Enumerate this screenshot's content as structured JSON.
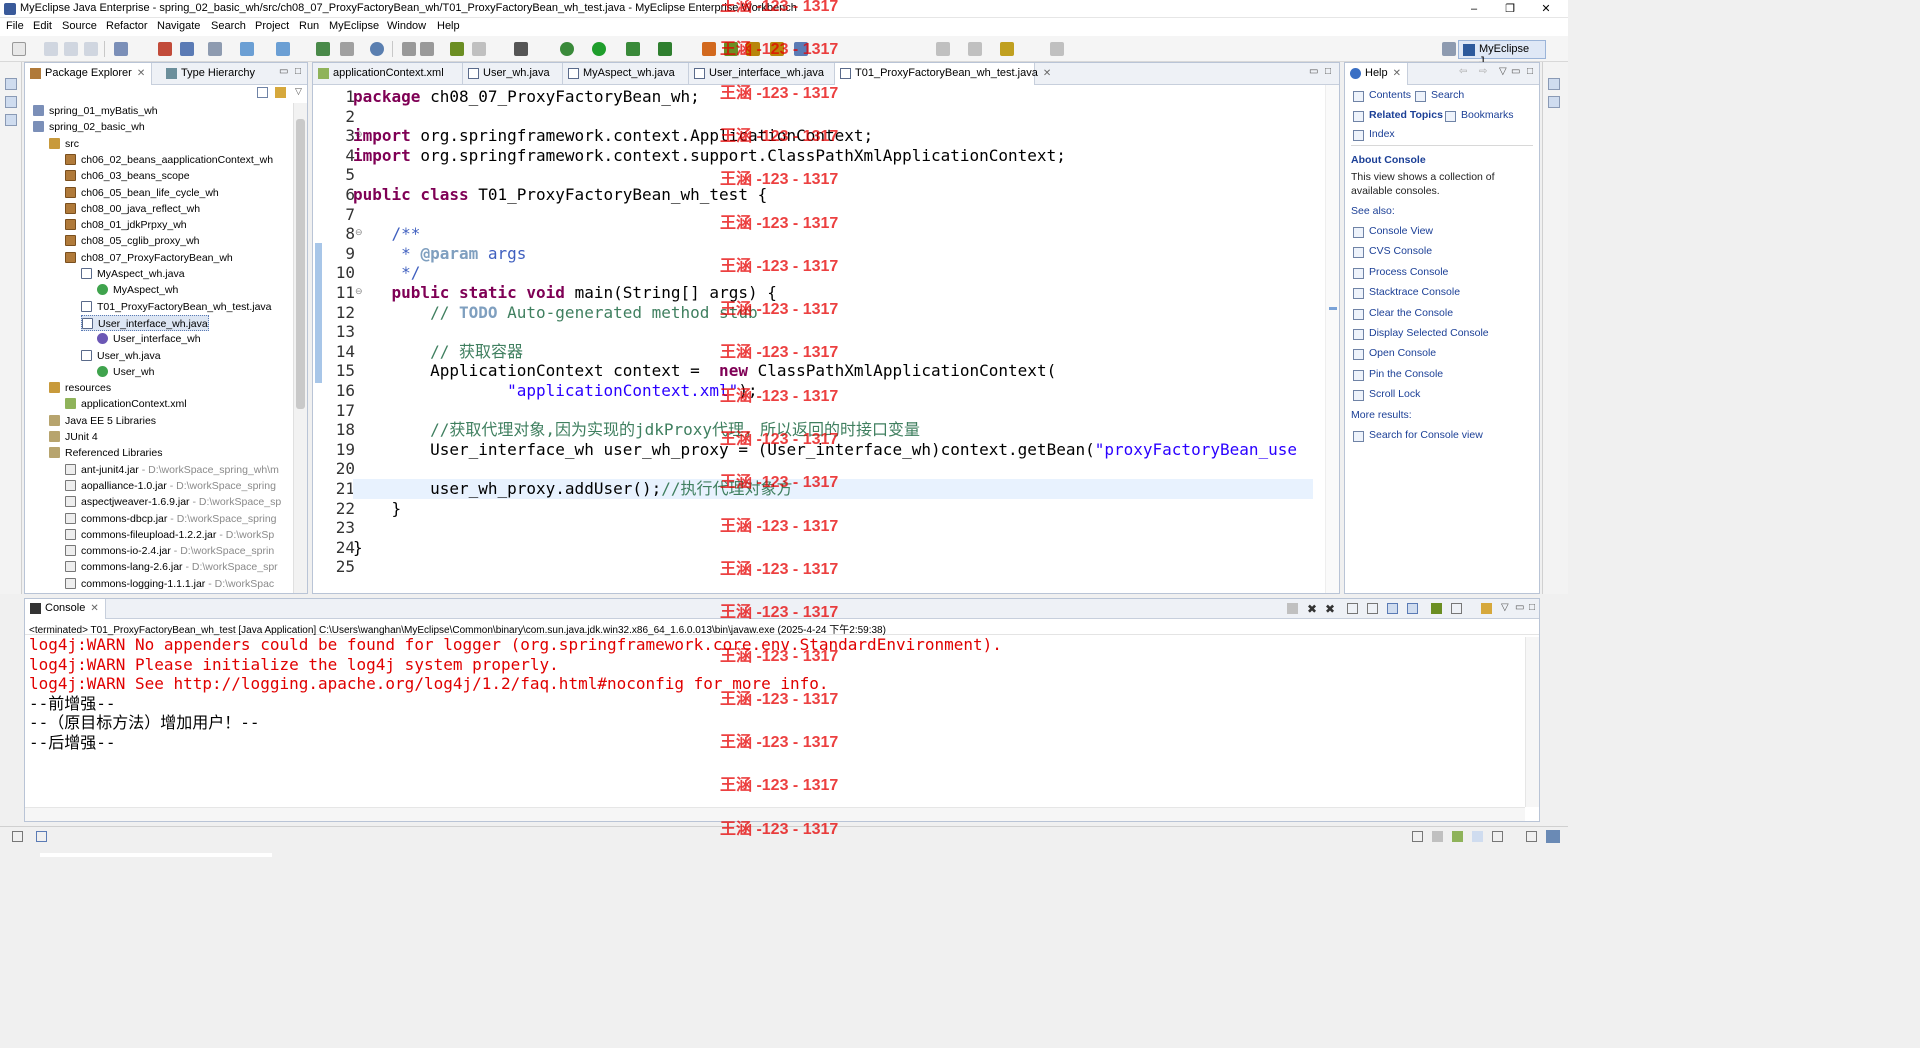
{
  "window": {
    "title": "MyEclipse Java Enterprise - spring_02_basic_wh/src/ch08_07_ProxyFactoryBean_wh/T01_ProxyFactoryBean_wh_test.java - MyEclipse Enterprise Workbench",
    "min": "–",
    "max": "❐",
    "close": "✕"
  },
  "menu": [
    "File",
    "Edit",
    "Source",
    "Refactor",
    "Navigate",
    "Search",
    "Project",
    "Run",
    "MyEclipse",
    "Window",
    "Help"
  ],
  "perspective": "MyEclipse J...",
  "package_explorer": {
    "tabs": [
      "Package Explorer",
      "Type Hierarchy"
    ],
    "tree": [
      {
        "label": "spring_01_myBatis_wh",
        "icon": "project-icon",
        "depth": 0
      },
      {
        "label": "spring_02_basic_wh",
        "icon": "project-icon",
        "depth": 0
      },
      {
        "label": "src",
        "icon": "source-folder-icon",
        "depth": 1
      },
      {
        "label": "ch06_02_beans_aapplicationContext_wh",
        "icon": "package-icon",
        "depth": 2
      },
      {
        "label": "ch06_03_beans_scope",
        "icon": "package-icon",
        "depth": 2
      },
      {
        "label": "ch06_05_bean_life_cycle_wh",
        "icon": "package-icon",
        "depth": 2
      },
      {
        "label": "ch08_00_java_reflect_wh",
        "icon": "package-icon",
        "depth": 2
      },
      {
        "label": "ch08_01_jdkPrpxy_wh",
        "icon": "package-icon",
        "depth": 2
      },
      {
        "label": "ch08_05_cglib_proxy_wh",
        "icon": "package-icon",
        "depth": 2
      },
      {
        "label": "ch08_07_ProxyFactoryBean_wh",
        "icon": "package-icon",
        "depth": 2
      },
      {
        "label": "MyAspect_wh.java",
        "icon": "java-file-icon",
        "depth": 3
      },
      {
        "label": "MyAspect_wh",
        "icon": "class-icon",
        "depth": 4
      },
      {
        "label": "T01_ProxyFactoryBean_wh_test.java",
        "icon": "java-file-icon",
        "depth": 3
      },
      {
        "label": "User_interface_wh.java",
        "icon": "java-file-icon",
        "depth": 3,
        "selected": true
      },
      {
        "label": "User_interface_wh",
        "icon": "interface-icon",
        "depth": 4
      },
      {
        "label": "User_wh.java",
        "icon": "java-file-icon",
        "depth": 3
      },
      {
        "label": "User_wh",
        "icon": "class-icon",
        "depth": 4
      },
      {
        "label": "resources",
        "icon": "source-folder-icon",
        "depth": 1
      },
      {
        "label": "applicationContext.xml",
        "icon": "xml-file-icon",
        "depth": 2
      },
      {
        "label": "Java EE 5 Libraries",
        "icon": "library-icon",
        "depth": 1
      },
      {
        "label": "JUnit 4",
        "icon": "library-icon",
        "depth": 1
      },
      {
        "label": "Referenced Libraries",
        "icon": "library-icon",
        "depth": 1
      },
      {
        "label": "ant-junit4.jar",
        "path": " - D:\\workSpace_spring_wh\\m",
        "icon": "jar-icon",
        "depth": 2
      },
      {
        "label": "aopalliance-1.0.jar",
        "path": " - D:\\workSpace_spring",
        "icon": "jar-icon",
        "depth": 2
      },
      {
        "label": "aspectjweaver-1.6.9.jar",
        "path": " - D:\\workSpace_sp",
        "icon": "jar-icon",
        "depth": 2
      },
      {
        "label": "commons-dbcp.jar",
        "path": " - D:\\workSpace_spring",
        "icon": "jar-icon",
        "depth": 2
      },
      {
        "label": "commons-fileupload-1.2.2.jar",
        "path": " - D:\\workSp",
        "icon": "jar-icon",
        "depth": 2
      },
      {
        "label": "commons-io-2.4.jar",
        "path": " - D:\\workSpace_sprin",
        "icon": "jar-icon",
        "depth": 2
      },
      {
        "label": "commons-lang-2.6.jar",
        "path": " - D:\\workSpace_spr",
        "icon": "jar-icon",
        "depth": 2
      },
      {
        "label": "commons-logging-1.1.1.jar",
        "path": " - D:\\workSpac",
        "icon": "jar-icon",
        "depth": 2
      }
    ]
  },
  "editor": {
    "tabs": [
      {
        "label": "applicationContext.xml",
        "icon": "xml-file-icon"
      },
      {
        "label": "User_wh.java",
        "icon": "java-file-icon"
      },
      {
        "label": "MyAspect_wh.java",
        "icon": "java-file-icon"
      },
      {
        "label": "User_interface_wh.java",
        "icon": "java-file-icon"
      },
      {
        "label": "T01_ProxyFactoryBean_wh_test.java",
        "icon": "java-file-icon",
        "active": true
      }
    ],
    "line_numbers": [
      "1",
      "2",
      "3",
      "4",
      "5",
      "6",
      "7",
      "8",
      "9",
      "10",
      "11",
      "12",
      "13",
      "14",
      "15",
      "16",
      "17",
      "18",
      "19",
      "20",
      "21",
      "22",
      "23",
      "24",
      "25"
    ],
    "fold_markers": {
      "3": "⊖",
      "8": "⊖",
      "11": "⊖"
    },
    "lines": [
      [
        [
          "kw",
          "package"
        ],
        [
          "",
          "ch08_07_ProxyFactoryBean_wh;"
        ]
      ],
      [],
      [
        [
          "kw",
          "import"
        ],
        [
          "",
          "org.springframework.context.ApplicationContext;"
        ]
      ],
      [
        [
          "kw",
          "import"
        ],
        [
          "",
          "org.springframework.context.support.ClassPathXmlApplicationContext;"
        ]
      ],
      [],
      [
        [
          "kw",
          "public"
        ],
        [
          "kw",
          "class"
        ],
        [
          "",
          "T01_ProxyFactoryBean_wh_test {"
        ]
      ],
      [],
      [
        [
          "jd",
          "    /**"
        ]
      ],
      [
        [
          "jd",
          "     * "
        ],
        [
          "jdtag",
          "@param"
        ],
        [
          "jd",
          " args"
        ]
      ],
      [
        [
          "jd",
          "     */"
        ]
      ],
      [
        [
          "kw",
          "    public"
        ],
        [
          "kw",
          "static"
        ],
        [
          "kw",
          "void"
        ],
        [
          "",
          "main(String[] args) {"
        ]
      ],
      [
        [
          "cm",
          "        // "
        ],
        [
          "todo",
          "TODO"
        ],
        [
          "cm",
          " Auto-generated method stub"
        ]
      ],
      [],
      [
        [
          "cm",
          "        // 获取容器"
        ]
      ],
      [
        [
          "",
          "        ApplicationContext context = "
        ],
        [
          "kw",
          "new"
        ],
        [
          "",
          " ClassPathXmlApplicationContext("
        ]
      ],
      [
        [
          "str",
          "                \"applicationContext.xml\""
        ],
        [
          "",
          ");"
        ]
      ],
      [],
      [
        [
          "cm",
          "        //获取代理对象,因为实现的jdkProxy代理，所以返回的时接口变量"
        ]
      ],
      [
        [
          "",
          "        User_interface_wh user_wh_proxy = (User_interface_wh)context.getBean("
        ],
        [
          "str",
          "\"proxyFactoryBean_use"
        ]
      ],
      [],
      [
        [
          "",
          "        user_wh_proxy.addUser();"
        ],
        [
          "cm",
          "//执行代理对象方"
        ]
      ],
      [
        [
          "",
          "    }"
        ]
      ],
      [],
      [
        [
          "",
          "}"
        ]
      ],
      []
    ]
  },
  "help": {
    "tab": "Help",
    "nav": [
      {
        "label": "Contents",
        "icon": "book-icon"
      },
      {
        "label": "Search",
        "icon": "search-icon"
      },
      {
        "label": "Related Topics",
        "icon": "related-topics-icon",
        "bold": true
      },
      {
        "label": "Bookmarks",
        "icon": "bookmark-icon"
      },
      {
        "label": "Index",
        "icon": "index-icon"
      }
    ],
    "about_title": "About Console",
    "about_text": "This view shows a collection of available consoles.",
    "see_also": "See also:",
    "links": [
      "Console View",
      "CVS Console",
      "Process Console",
      "Stacktrace Console",
      "Clear the Console",
      "Display Selected Console",
      "Open Console",
      "Pin the Console",
      "Scroll Lock"
    ],
    "more_results": "More results:",
    "search_link": "Search for Console view"
  },
  "console": {
    "tab": "Console",
    "status": "<terminated> T01_ProxyFactoryBean_wh_test [Java Application] C:\\Users\\wanghan\\MyEclipse\\Common\\binary\\com.sun.java.jdk.win32.x86_64_1.6.0.013\\bin\\javaw.exe (2025-4-24 下午2:59:38)",
    "lines": [
      {
        "text": "log4j:WARN No appenders could be found for logger (org.springframework.core.env.StandardEnvironment).",
        "err": true
      },
      {
        "text": "log4j:WARN Please initialize the log4j system properly.",
        "err": true
      },
      {
        "text": "log4j:WARN See http://logging.apache.org/log4j/1.2/faq.html#noconfig for more info.",
        "err": true
      },
      {
        "text": "--前增强--",
        "err": false
      },
      {
        "text": "--（原目标方法）增加用户！--",
        "err": false
      },
      {
        "text": "--后增强--",
        "err": false
      }
    ]
  },
  "watermark": "王涵 -123 - 1317",
  "colors": {
    "keyword": "#7f0055",
    "comment": "#3f7f5f",
    "javadoc": "#3f5fbf",
    "string": "#2a00ff",
    "console_error": "#e00000",
    "watermark": "#e60000"
  }
}
